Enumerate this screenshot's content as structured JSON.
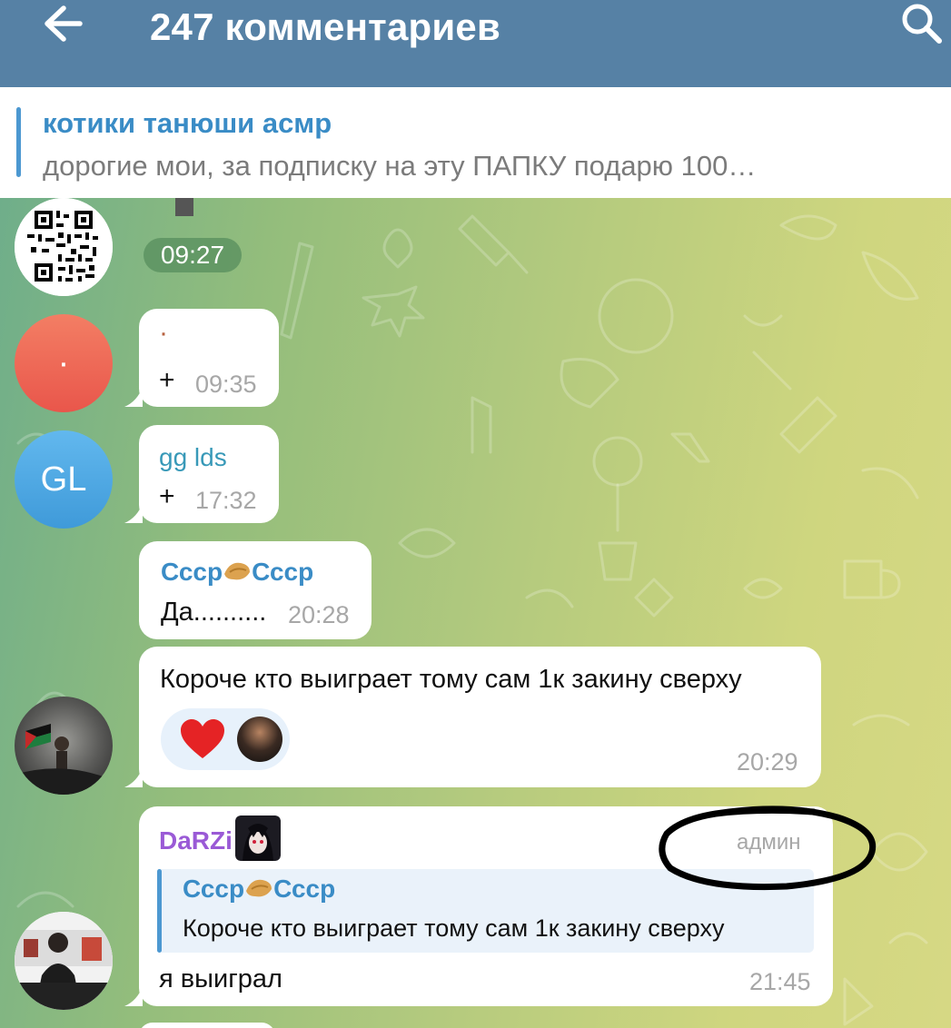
{
  "header": {
    "title": "247 комментариев",
    "back_icon": "arrow-left-icon",
    "search_icon": "search-icon",
    "bg": "#5681a5"
  },
  "pinned": {
    "title": "котики танюши асмр",
    "text": "дорогие мои, за подписку на эту ПАПКУ подарю 100…"
  },
  "messages": [
    {
      "time": "09:27"
    },
    {
      "avatar_text": "·",
      "text": "·",
      "plus": "+",
      "time": "09:35"
    },
    {
      "avatar_text": "GL",
      "sender": "gg lds",
      "plus": "+",
      "time": "17:32"
    },
    {
      "sender": "Ссср",
      "sender2": "Ссср",
      "text": "Да..........",
      "time": "20:28"
    },
    {
      "text": "Короче кто выиграет тому сам 1к закину сверху",
      "reaction": "heart",
      "time": "20:29"
    },
    {
      "sender": "DaRZi",
      "badge": "админ",
      "reply": {
        "sender": "Ссср",
        "sender2": "Ссср",
        "text": "Короче кто выиграет тому сам 1к закину сверху"
      },
      "text": "я выиграл",
      "time": "21:45"
    }
  ],
  "colors": {
    "accent_blue": "#3a8cc6",
    "sender_teal": "#3899b8",
    "sender_purple": "#9a5ad6",
    "time_gray": "#a7a7a7"
  }
}
